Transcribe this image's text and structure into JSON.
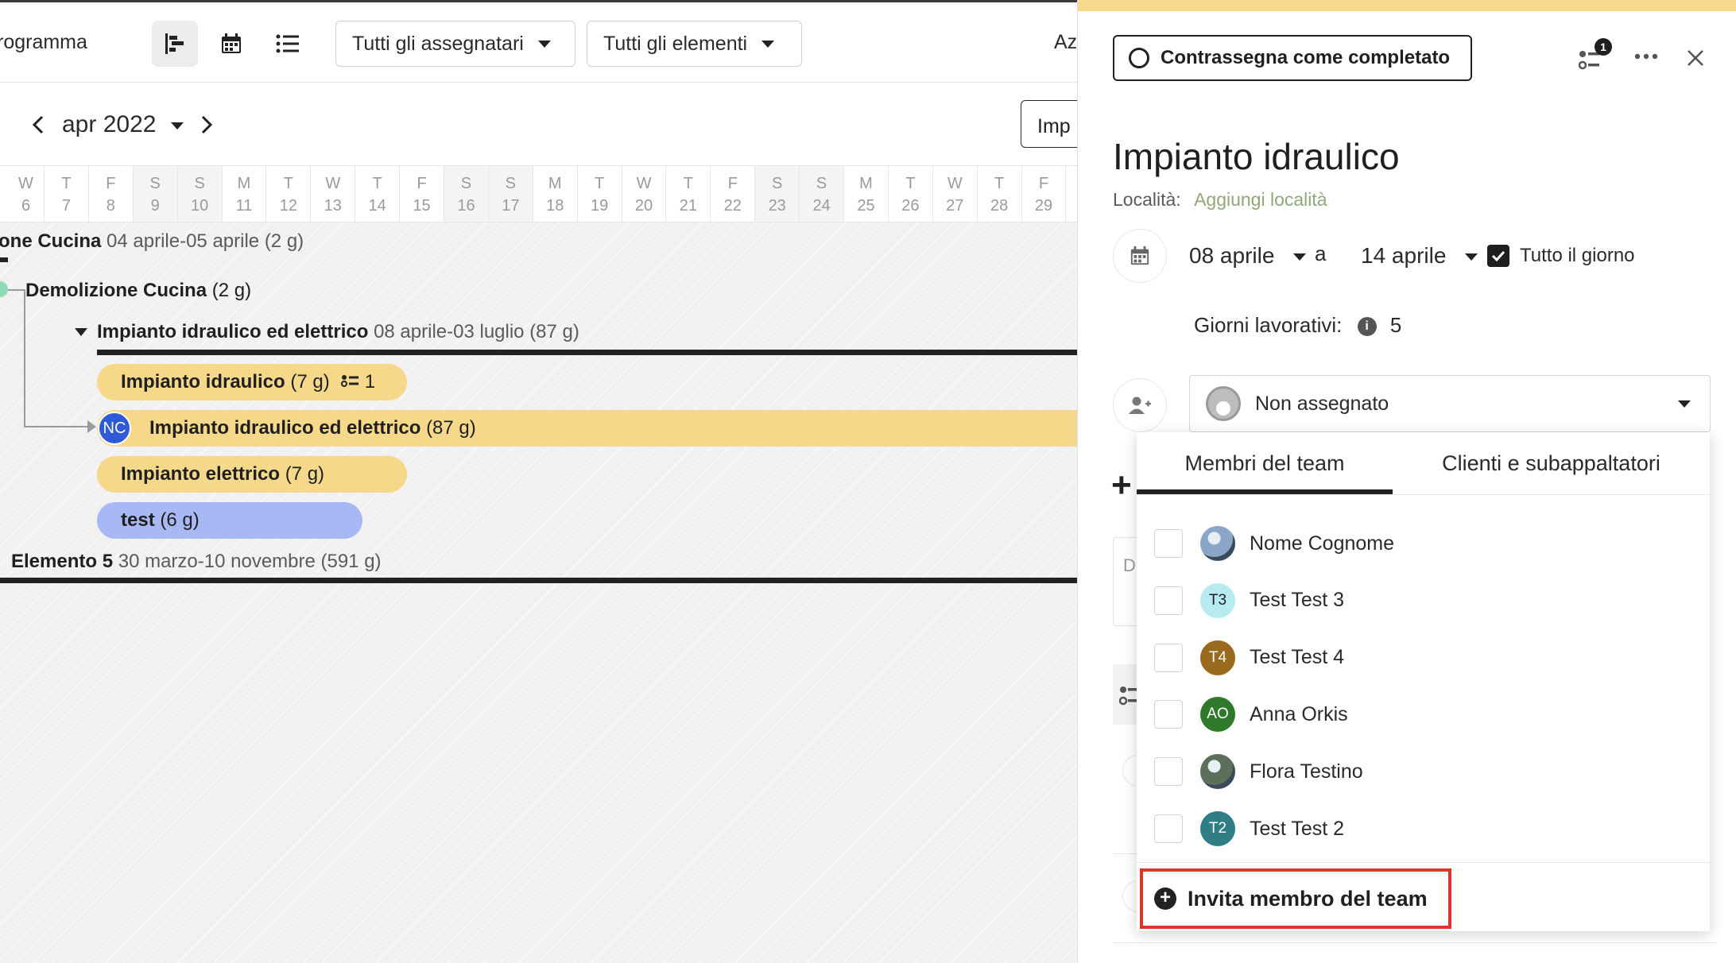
{
  "toolbar": {
    "page_title": "rogramma",
    "assignee_filter": "Tutti gli assegnatari",
    "element_filter": "Tutti gli elementi",
    "cut_label": "Az"
  },
  "calendar": {
    "month_label": "apr 2022",
    "import_button": "Imp",
    "days": [
      {
        "l": "W",
        "n": "6",
        "we": false
      },
      {
        "l": "T",
        "n": "7",
        "we": false
      },
      {
        "l": "F",
        "n": "8",
        "we": false
      },
      {
        "l": "S",
        "n": "9",
        "we": true
      },
      {
        "l": "S",
        "n": "10",
        "we": true
      },
      {
        "l": "M",
        "n": "11",
        "we": false
      },
      {
        "l": "T",
        "n": "12",
        "we": false
      },
      {
        "l": "W",
        "n": "13",
        "we": false
      },
      {
        "l": "T",
        "n": "14",
        "we": false
      },
      {
        "l": "F",
        "n": "15",
        "we": false
      },
      {
        "l": "S",
        "n": "16",
        "we": true
      },
      {
        "l": "S",
        "n": "17",
        "we": true
      },
      {
        "l": "M",
        "n": "18",
        "we": false
      },
      {
        "l": "T",
        "n": "19",
        "we": false
      },
      {
        "l": "W",
        "n": "20",
        "we": false
      },
      {
        "l": "T",
        "n": "21",
        "we": false
      },
      {
        "l": "F",
        "n": "22",
        "we": false
      },
      {
        "l": "S",
        "n": "23",
        "we": true
      },
      {
        "l": "S",
        "n": "24",
        "we": true
      },
      {
        "l": "M",
        "n": "25",
        "we": false
      },
      {
        "l": "T",
        "n": "26",
        "we": false
      },
      {
        "l": "W",
        "n": "27",
        "we": false
      },
      {
        "l": "T",
        "n": "28",
        "we": false
      },
      {
        "l": "F",
        "n": "29",
        "we": false
      }
    ]
  },
  "gantt": {
    "row1_name": "one Cucina",
    "row1_dates": "04 aprile-05 aprile (2 g)",
    "row2_name": "Demolizione Cucina",
    "row2_dur": "(2 g)",
    "group_name": "Impianto idraulico ed elettrico",
    "group_dates": "08 aprile-03 luglio (87 g)",
    "task1_name": "Impianto idraulico",
    "task1_dur": "(7 g)",
    "task1_subtasks": "1",
    "task2_badge": "NC",
    "task2_name": "Impianto idraulico ed elettrico",
    "task2_dur": "(87 g)",
    "task3_name": "Impianto elettrico",
    "task3_dur": "(7 g)",
    "task4_name": "test",
    "task4_dur": "(6 g)",
    "row_last_name": "Elemento 5",
    "row_last_dates": "30 marzo-10 novembre (591 g)"
  },
  "panel": {
    "complete_button": "Contrassegna come completato",
    "subtask_count": "1",
    "title": "Impianto idraulico",
    "location_label": "Località:",
    "location_link": "Aggiungi località",
    "start_date": "08 aprile",
    "to_label": "a",
    "end_date": "14 aprile",
    "all_day_label": "Tutto il giorno",
    "working_days_label": "Giorni lavorativi:",
    "working_days_value": "5",
    "assignee_value": "Non assegnato",
    "ghost_text": "D"
  },
  "menu": {
    "tab_team": "Membri del team",
    "tab_clients": "Clienti e subappaltatori",
    "members": [
      {
        "name": "Nome Cognome",
        "initials": "",
        "color": "#8aa6c9",
        "photo": true
      },
      {
        "name": "Test Test 3",
        "initials": "T3",
        "color": "#b6ecf0",
        "photo": false
      },
      {
        "name": "Test Test 4",
        "initials": "T4",
        "color": "#9a6a1e",
        "photo": false
      },
      {
        "name": "Anna Orkis",
        "initials": "AO",
        "color": "#2f7a2a",
        "photo": false
      },
      {
        "name": "Flora Testino",
        "initials": "",
        "color": "#5b6f5a",
        "photo": true
      },
      {
        "name": "Test Test 2",
        "initials": "T2",
        "color": "#2f7d85",
        "photo": false
      }
    ],
    "invite_label": "Invita membro del team"
  },
  "colors": {
    "accent_yellow": "#f6d88a",
    "accent_blue": "#a8b8f4",
    "highlight_red": "#d9372a",
    "badge_blue": "#2f5ad8"
  }
}
